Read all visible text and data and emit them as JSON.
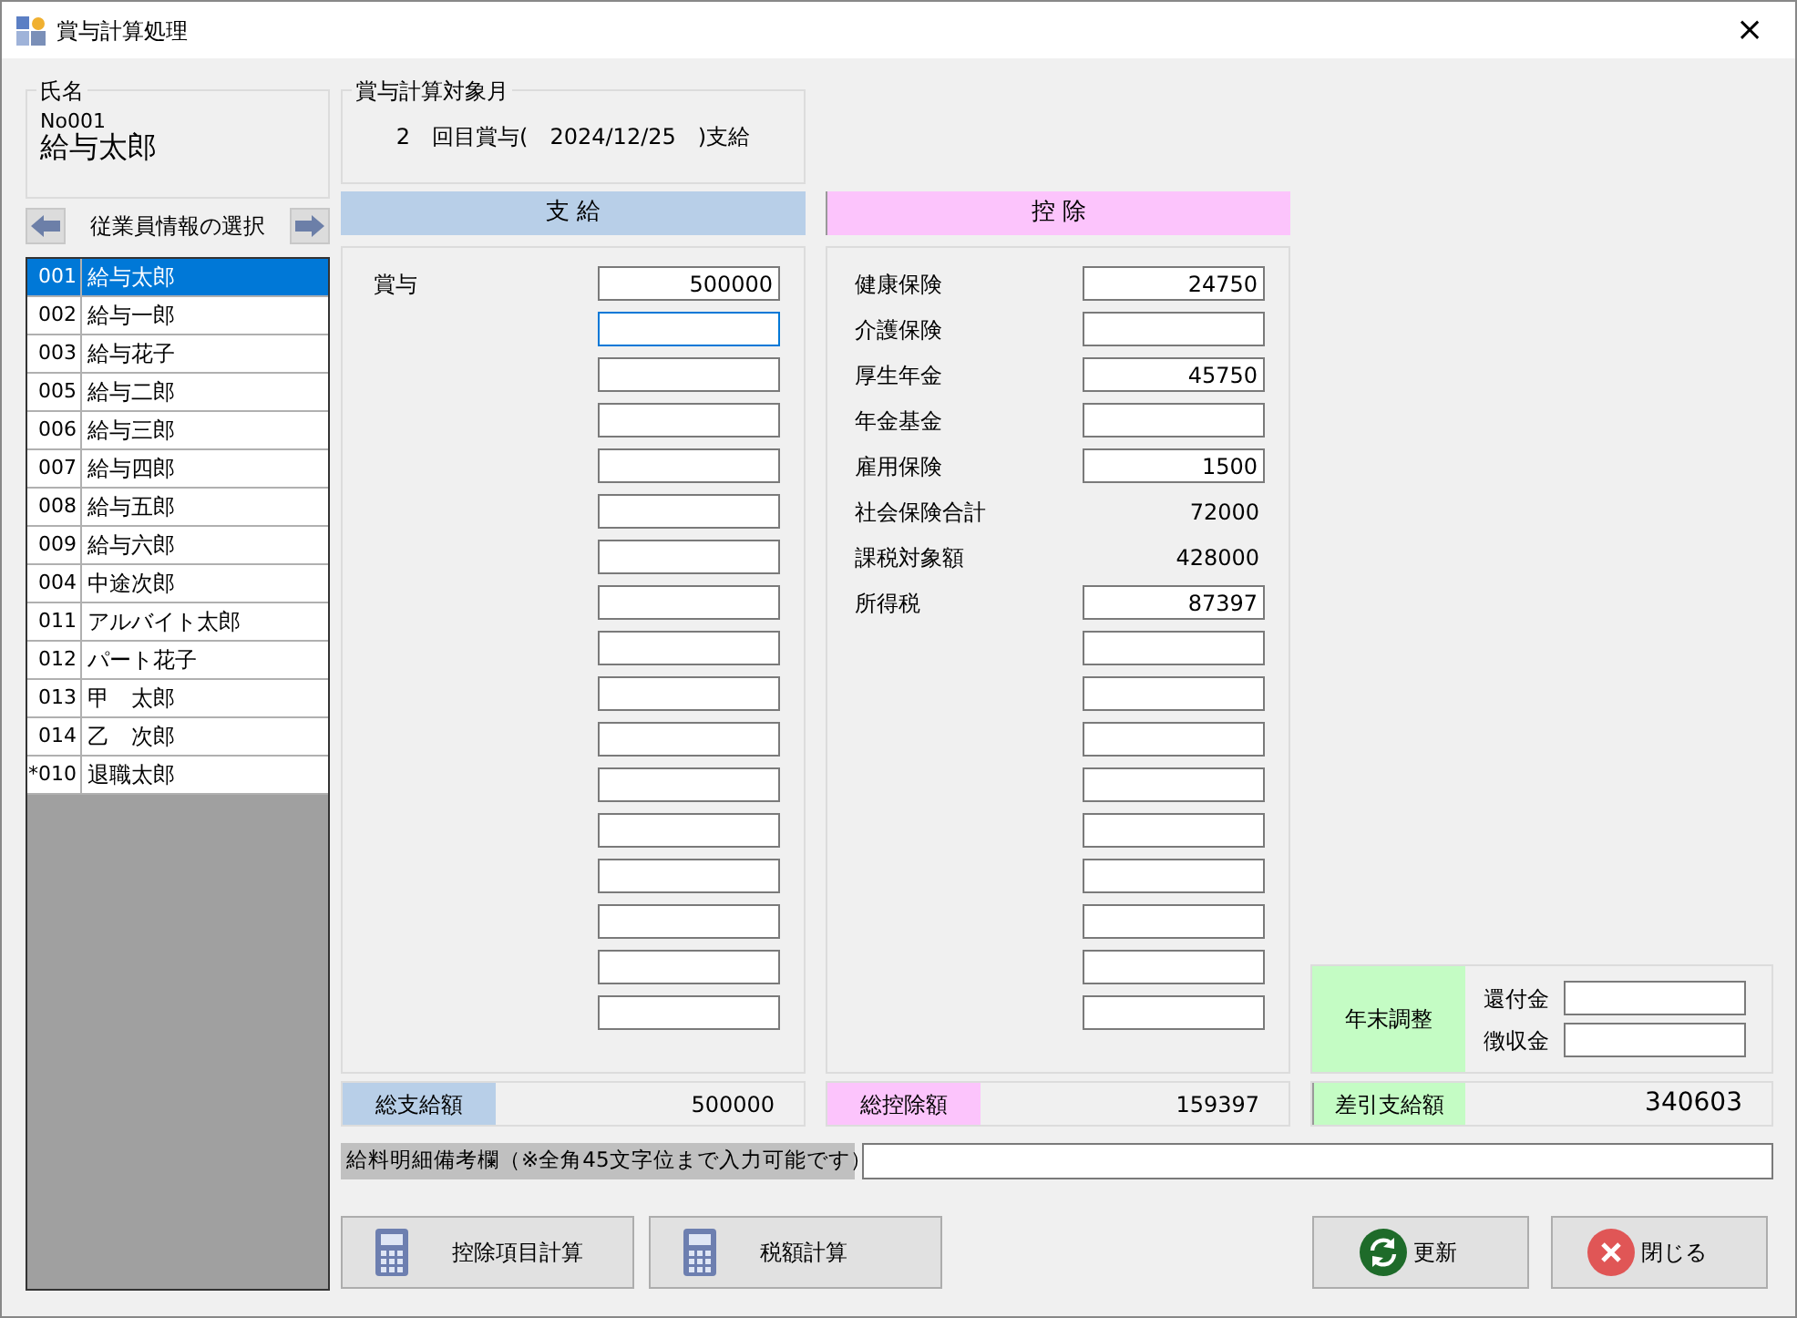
{
  "window": {
    "title": "賞与計算処理",
    "close": "×"
  },
  "name_group": {
    "title": "氏名",
    "number": "No001",
    "name": "給与太郎"
  },
  "employee_nav": {
    "label": "従業員情報の選択"
  },
  "employees": [
    {
      "code": "001",
      "name": "給与太郎",
      "selected": true
    },
    {
      "code": "002",
      "name": "給与一郎",
      "selected": false
    },
    {
      "code": "003",
      "name": "給与花子",
      "selected": false
    },
    {
      "code": "005",
      "name": "給与二郎",
      "selected": false
    },
    {
      "code": "006",
      "name": "給与三郎",
      "selected": false
    },
    {
      "code": "007",
      "name": "給与四郎",
      "selected": false
    },
    {
      "code": "008",
      "name": "給与五郎",
      "selected": false
    },
    {
      "code": "009",
      "name": "給与六郎",
      "selected": false
    },
    {
      "code": "004",
      "name": "中途次郎",
      "selected": false
    },
    {
      "code": "011",
      "name": "アルバイト太郎",
      "selected": false
    },
    {
      "code": "012",
      "name": "パート花子",
      "selected": false
    },
    {
      "code": "013",
      "name": "甲　太郎",
      "selected": false
    },
    {
      "code": "014",
      "name": "乙　次郎",
      "selected": false
    },
    {
      "code": "*010",
      "name": "退職太郎",
      "selected": false
    }
  ],
  "period_group": {
    "title": "賞与計算対象月",
    "text": "2　回目賞与(　2024/12/25　)支給"
  },
  "payments": {
    "header": "支 給",
    "rows": [
      {
        "label": "賞与",
        "value": "500000",
        "focused": false
      },
      {
        "focused": true
      },
      {
        "focused": false
      },
      {
        "focused": false
      },
      {
        "focused": false
      },
      {
        "focused": false
      },
      {
        "focused": false
      },
      {
        "focused": false
      },
      {
        "focused": false
      },
      {
        "focused": false
      },
      {
        "focused": false
      },
      {
        "focused": false
      },
      {
        "focused": false
      },
      {
        "focused": false
      },
      {
        "focused": false
      },
      {
        "focused": false
      },
      {
        "focused": false
      }
    ],
    "total_label": "総支給額",
    "total_value": "500000"
  },
  "deductions": {
    "header": "控 除",
    "rows": [
      {
        "kind": "input",
        "label": "健康保険",
        "value": "24750"
      },
      {
        "kind": "input",
        "label": "介護保険"
      },
      {
        "kind": "input",
        "label": "厚生年金",
        "value": "45750"
      },
      {
        "kind": "input",
        "label": "年金基金"
      },
      {
        "kind": "input",
        "label": "雇用保険",
        "value": "1500"
      },
      {
        "kind": "display",
        "label": "社会保険合計",
        "value": "72000"
      },
      {
        "kind": "display",
        "label": "課税対象額",
        "value": "428000"
      },
      {
        "kind": "input",
        "label": "所得税",
        "value": "87397"
      },
      {
        "kind": "input"
      },
      {
        "kind": "input"
      },
      {
        "kind": "input"
      },
      {
        "kind": "input"
      },
      {
        "kind": "input"
      },
      {
        "kind": "input"
      },
      {
        "kind": "input"
      },
      {
        "kind": "input"
      },
      {
        "kind": "input"
      }
    ],
    "total_label": "総控除額",
    "total_value": "159397"
  },
  "year_end": {
    "label": "年末調整",
    "fields": [
      {
        "label": "還付金"
      },
      {
        "label": "徴収金"
      }
    ]
  },
  "net_pay": {
    "label": "差引支給額",
    "value": "340603"
  },
  "remarks": {
    "label": "給料明細備考欄（※全角45文字位まで入力可能です）"
  },
  "buttons": [
    {
      "kind": "calculator",
      "label": "控除項目計算"
    },
    {
      "kind": "calculator",
      "label": "税額計算"
    },
    {
      "kind": "refresh",
      "label": "更新"
    },
    {
      "kind": "close",
      "label": "閉じる"
    }
  ]
}
